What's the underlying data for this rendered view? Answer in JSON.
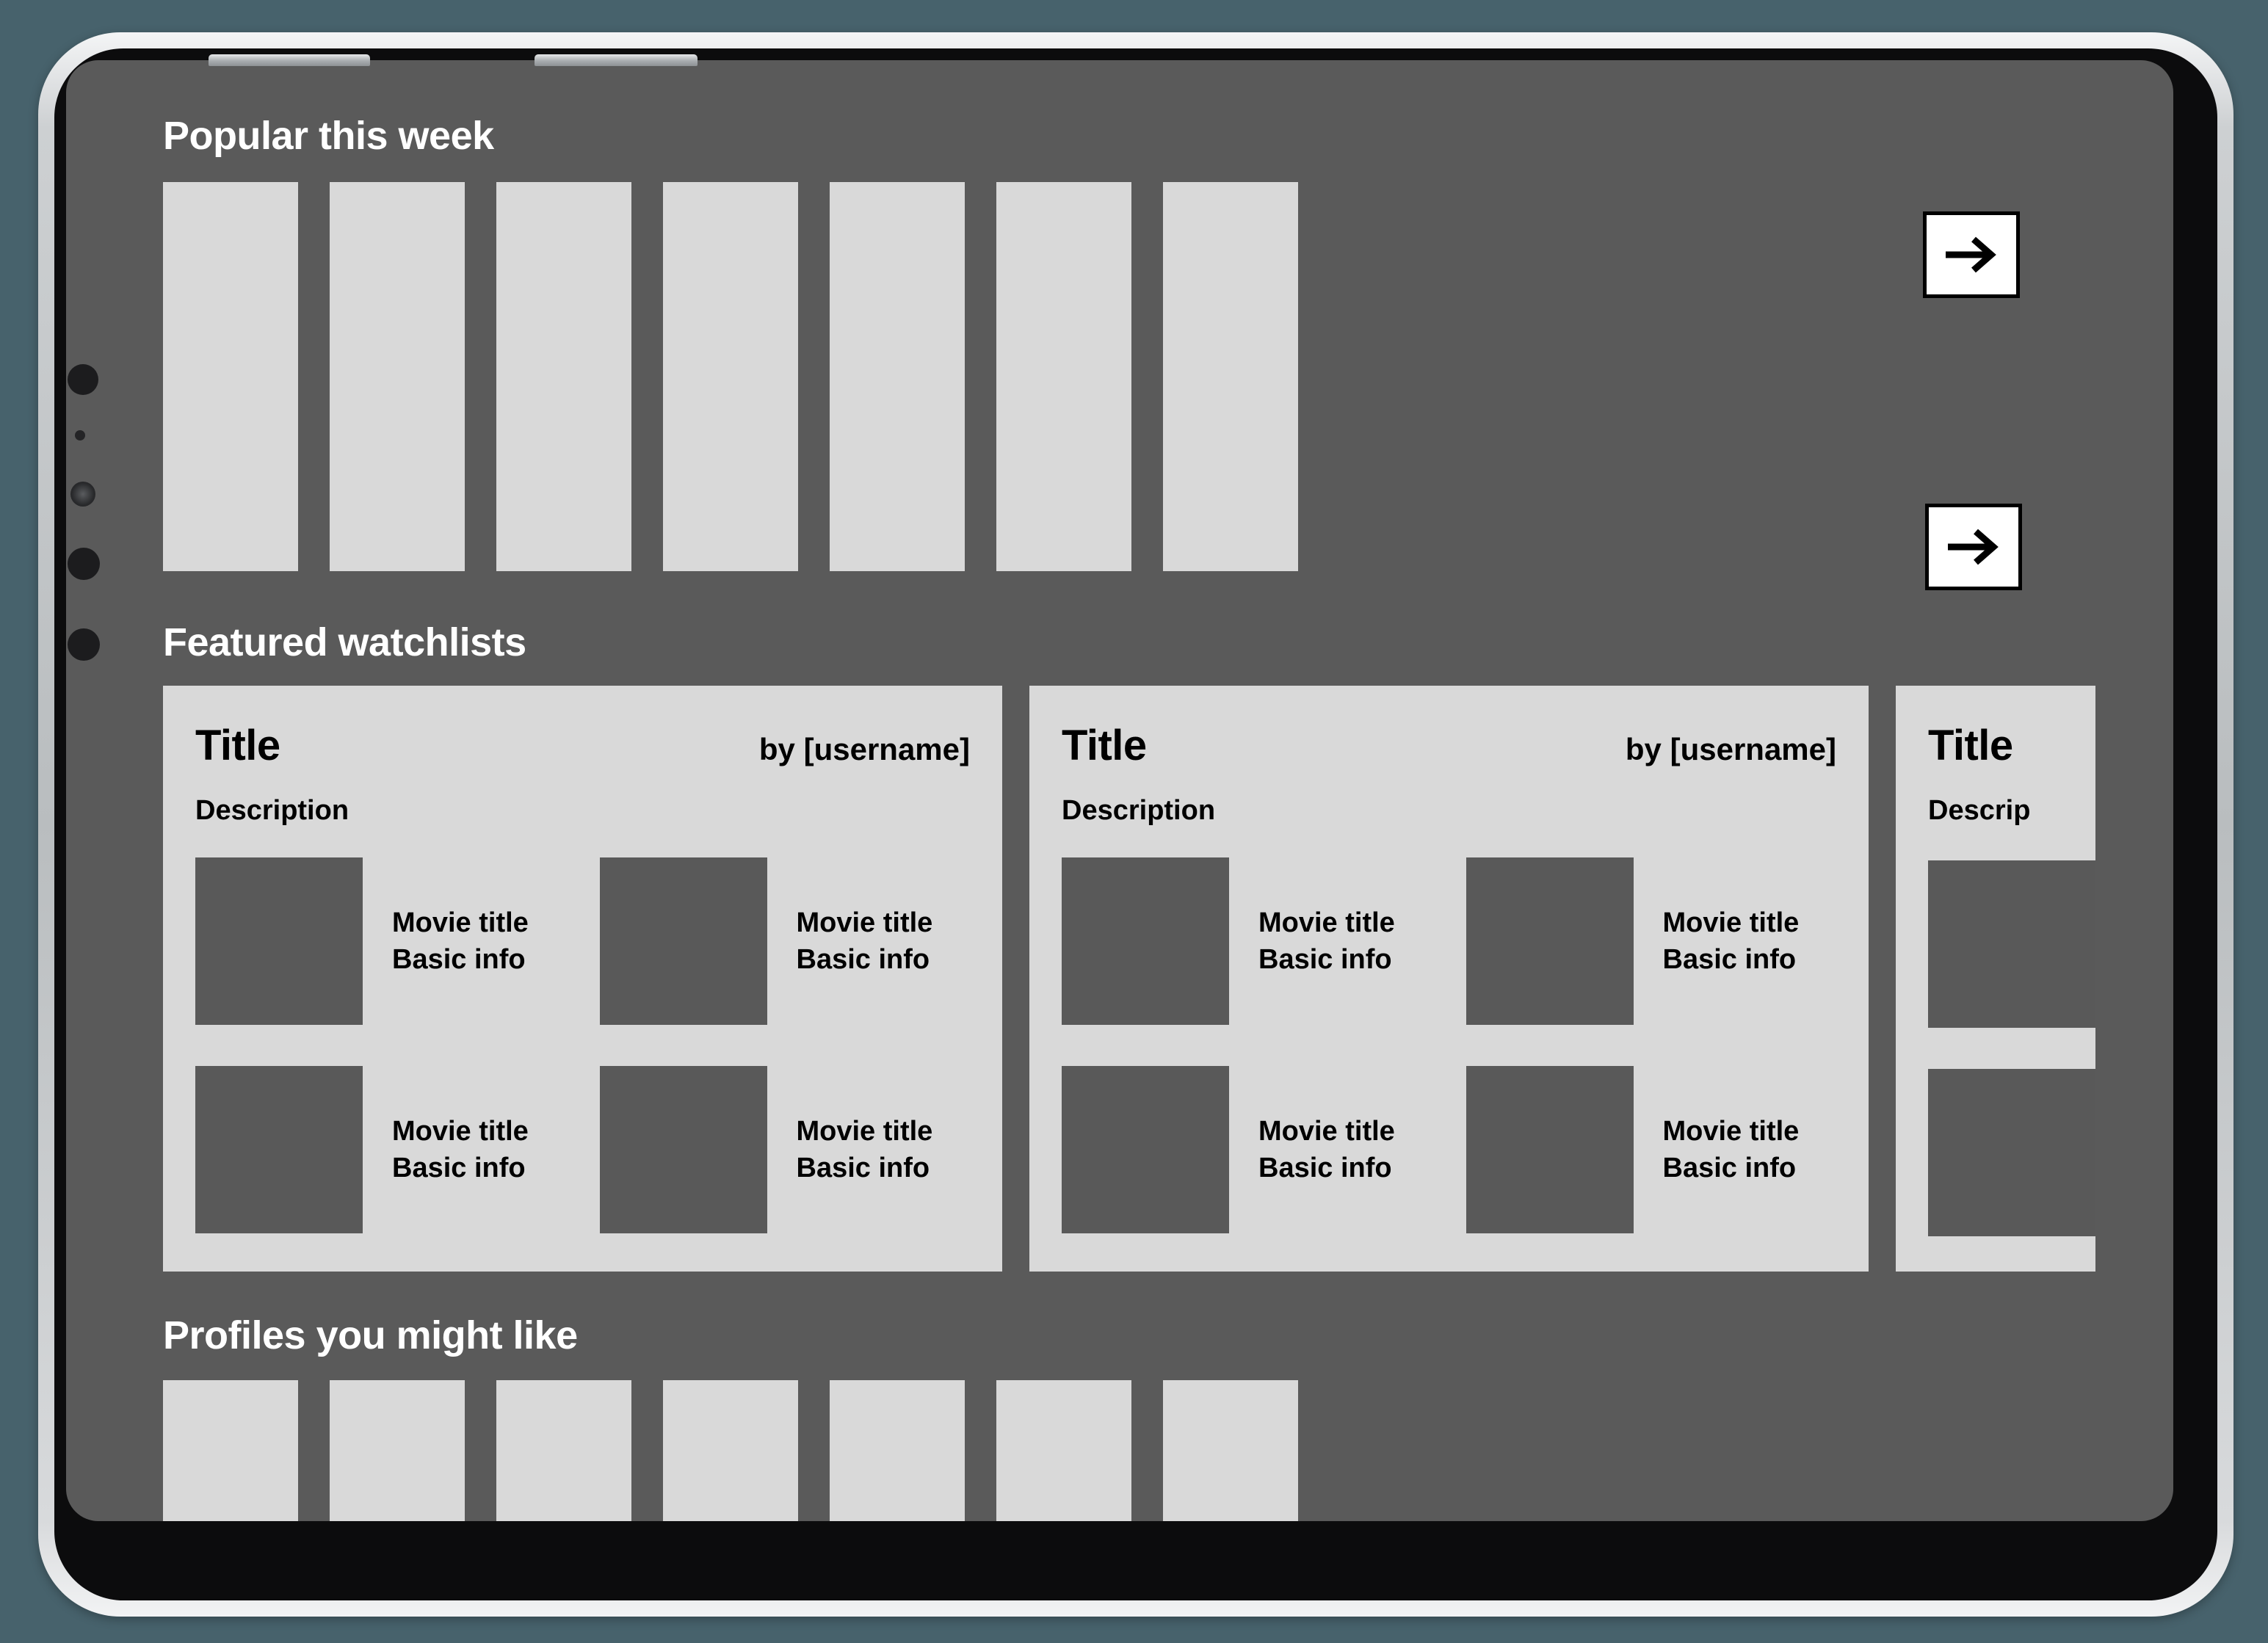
{
  "device": {
    "name": "tablet-device",
    "buttons": [
      "volume-up",
      "volume-down"
    ],
    "colors": {
      "page_background": "#47626c",
      "frame_metal": "#b9bdbf",
      "bezel": "#0c0c0d",
      "content_panel": "#5a5a5a",
      "card_surface": "#d9d9d9",
      "tile_surface": "#d9d9d9",
      "thumbnail": "#595959",
      "heading_text": "#ffffff",
      "body_text": "#000000",
      "button_surface": "#ffffff",
      "button_border": "#000000"
    }
  },
  "sections": {
    "popular": {
      "heading": "Popular this week",
      "tiles": [
        "",
        "",
        "",
        "",
        "",
        "",
        ""
      ],
      "next_button_label": "→"
    },
    "featured": {
      "heading": "Featured watchlists",
      "next_button_label": "→",
      "cards": [
        {
          "title": "Title",
          "author": "by [username]",
          "description": "Description",
          "movies": [
            {
              "title": "Movie title",
              "info": "Basic info"
            },
            {
              "title": "Movie title",
              "info": "Basic info"
            },
            {
              "title": "Movie title",
              "info": "Basic info"
            },
            {
              "title": "Movie title",
              "info": "Basic info"
            }
          ]
        },
        {
          "title": "Title",
          "author": "by [username]",
          "description": "Description",
          "movies": [
            {
              "title": "Movie title",
              "info": "Basic info"
            },
            {
              "title": "Movie title",
              "info": "Basic info"
            },
            {
              "title": "Movie title",
              "info": "Basic info"
            },
            {
              "title": "Movie title",
              "info": "Basic info"
            }
          ]
        },
        {
          "title": "Title",
          "description": "Descrip"
        }
      ]
    },
    "profiles": {
      "heading": "Profiles you might like",
      "tiles": [
        "",
        "",
        "",
        "",
        "",
        "",
        ""
      ]
    }
  }
}
